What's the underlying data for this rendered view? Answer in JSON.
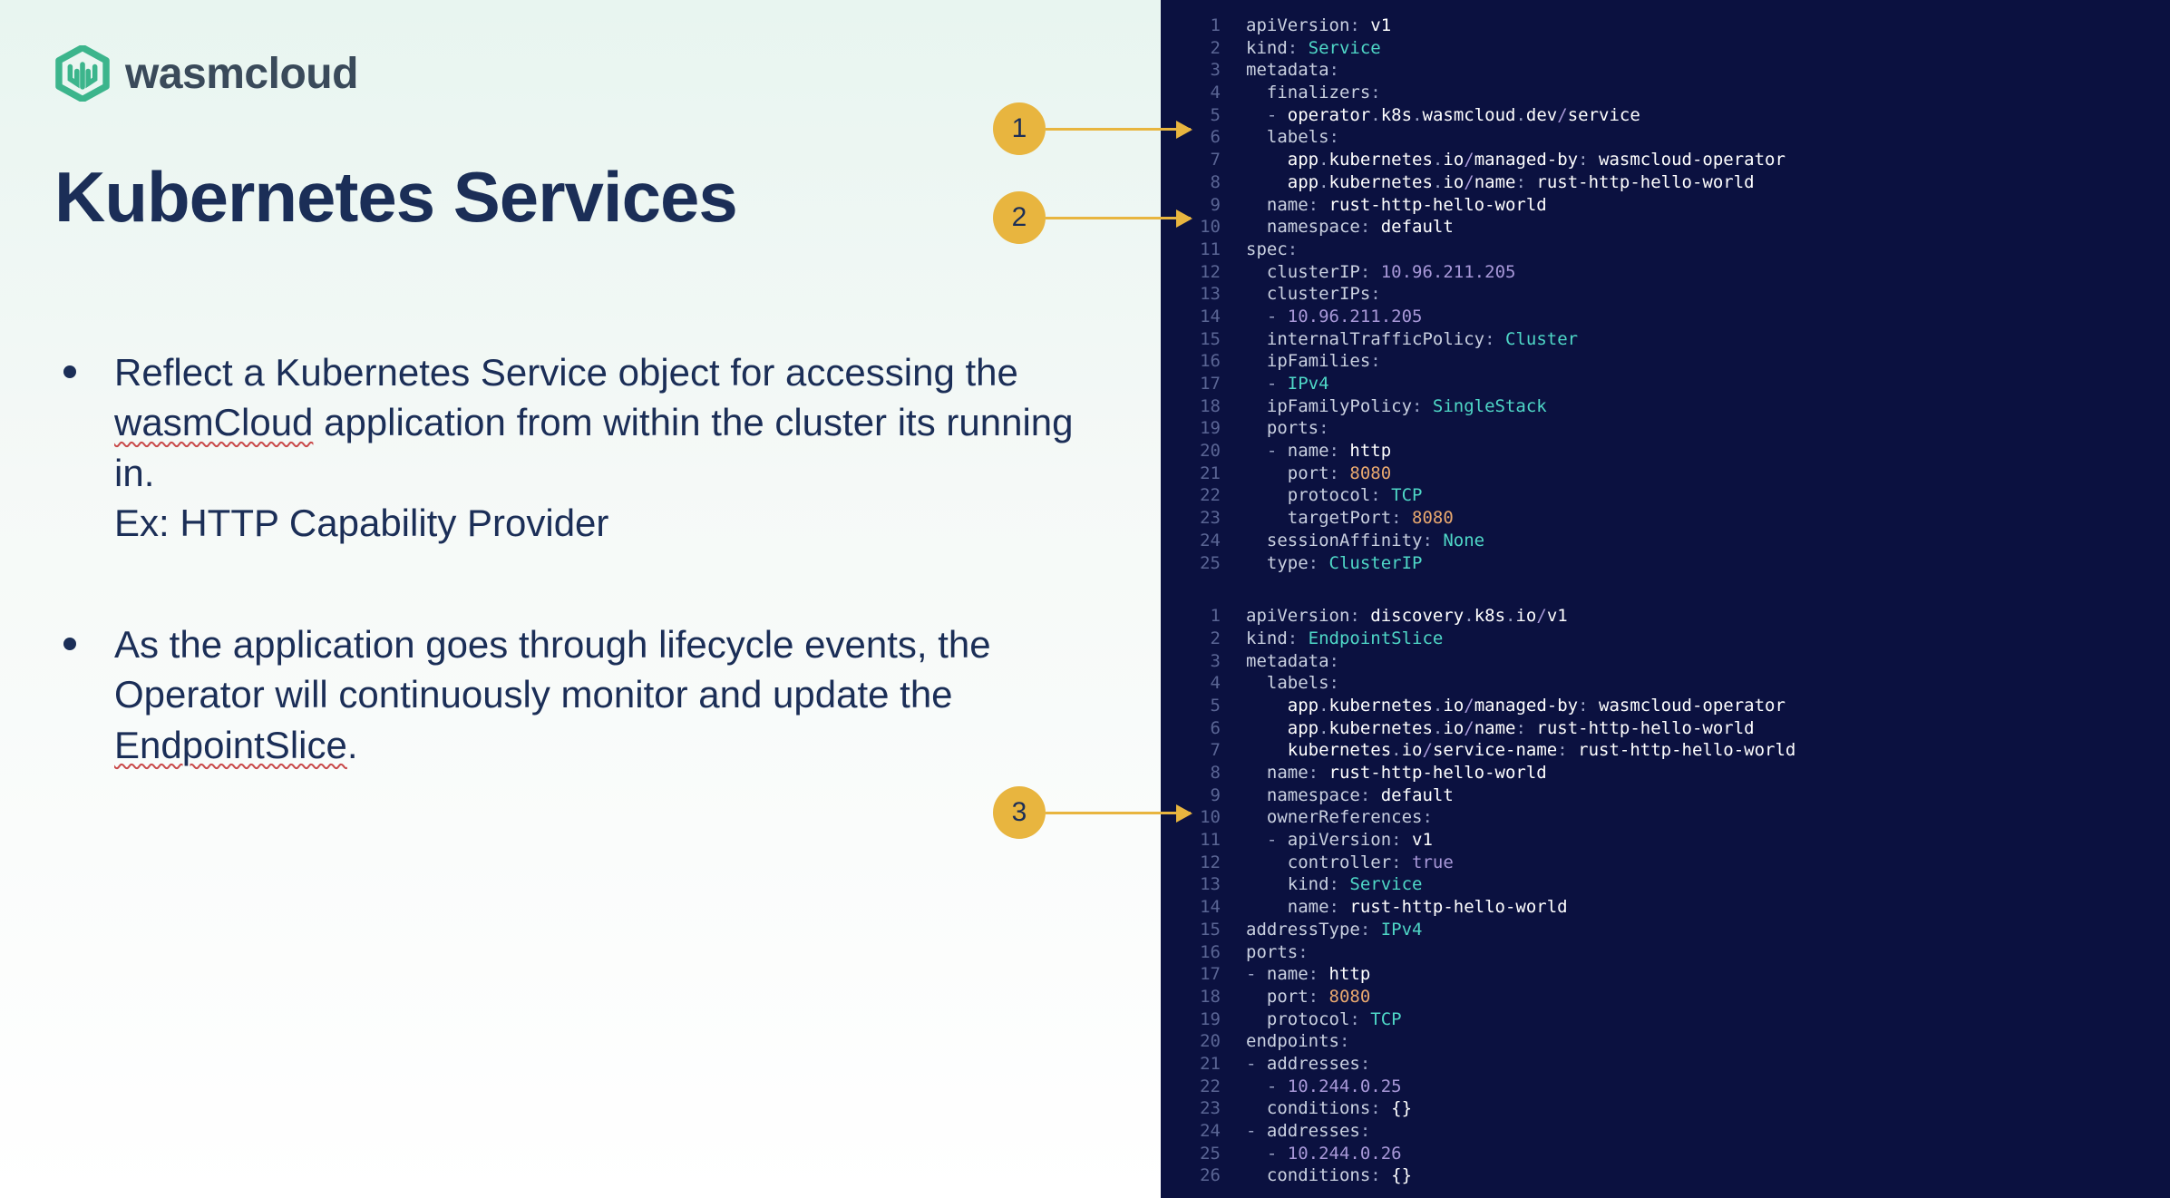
{
  "logo_text": "wasmcloud",
  "title": "Kubernetes Services",
  "bullet1_part1": "Reflect a Kubernetes Service object for accessing the ",
  "bullet1_underline1": "wasmCloud",
  "bullet1_part2": " application from within the cluster its running in.",
  "bullet1_ex": "Ex: HTTP Capability Provider",
  "bullet2_part1": "As the application goes through lifecycle events, the Operator will continuously monitor and update the ",
  "bullet2_underline": "EndpointSlice",
  "bullet2_part2": ".",
  "annot": {
    "a1": "1",
    "a2": "2",
    "a3": "3"
  },
  "code1": [
    {
      "n": "1",
      "segs": [
        [
          "apiVersion",
          "key"
        ],
        [
          ": ",
          "p"
        ],
        [
          "v1",
          "white"
        ]
      ]
    },
    {
      "n": "2",
      "segs": [
        [
          "kind",
          "key"
        ],
        [
          ": ",
          "p"
        ],
        [
          "Service",
          "cyan"
        ]
      ]
    },
    {
      "n": "3",
      "segs": [
        [
          "metadata",
          "key"
        ],
        [
          ":",
          "p"
        ]
      ]
    },
    {
      "n": "4",
      "segs": [
        [
          "  finalizers",
          "key"
        ],
        [
          ":",
          "p"
        ]
      ]
    },
    {
      "n": "5",
      "segs": [
        [
          "  - ",
          "dash"
        ],
        [
          "operator",
          "white"
        ],
        [
          ".",
          "p"
        ],
        [
          "k8s",
          "white"
        ],
        [
          ".",
          "p"
        ],
        [
          "wasmcloud",
          "white"
        ],
        [
          ".",
          "p"
        ],
        [
          "dev",
          "white"
        ],
        [
          "/",
          "purple"
        ],
        [
          "service",
          "white"
        ]
      ]
    },
    {
      "n": "6",
      "segs": [
        [
          "  labels",
          "key"
        ],
        [
          ":",
          "p"
        ]
      ]
    },
    {
      "n": "7",
      "segs": [
        [
          "    app",
          "white"
        ],
        [
          ".",
          "p"
        ],
        [
          "kubernetes",
          "white"
        ],
        [
          ".",
          "p"
        ],
        [
          "io",
          "white"
        ],
        [
          "/",
          "purple"
        ],
        [
          "managed-by",
          "white"
        ],
        [
          ": ",
          "p"
        ],
        [
          "wasmcloud-operator",
          "white"
        ]
      ]
    },
    {
      "n": "8",
      "segs": [
        [
          "    app",
          "white"
        ],
        [
          ".",
          "p"
        ],
        [
          "kubernetes",
          "white"
        ],
        [
          ".",
          "p"
        ],
        [
          "io",
          "white"
        ],
        [
          "/",
          "purple"
        ],
        [
          "name",
          "white"
        ],
        [
          ": ",
          "p"
        ],
        [
          "rust-http-hello-world",
          "white"
        ]
      ]
    },
    {
      "n": "9",
      "segs": [
        [
          "  name",
          "key"
        ],
        [
          ": ",
          "p"
        ],
        [
          "rust-http-hello-world",
          "white"
        ]
      ]
    },
    {
      "n": "10",
      "segs": [
        [
          "  namespace",
          "key"
        ],
        [
          ": ",
          "p"
        ],
        [
          "default",
          "white"
        ]
      ]
    },
    {
      "n": "11",
      "segs": [
        [
          "spec",
          "key"
        ],
        [
          ":",
          "p"
        ]
      ]
    },
    {
      "n": "12",
      "segs": [
        [
          "  clusterIP",
          "key"
        ],
        [
          ": ",
          "p"
        ],
        [
          "10.96.211.205",
          "purple"
        ]
      ]
    },
    {
      "n": "13",
      "segs": [
        [
          "  clusterIPs",
          "key"
        ],
        [
          ":",
          "p"
        ]
      ]
    },
    {
      "n": "14",
      "segs": [
        [
          "  - ",
          "dash"
        ],
        [
          "10.96.211.205",
          "purple"
        ]
      ]
    },
    {
      "n": "15",
      "segs": [
        [
          "  internalTrafficPolicy",
          "key"
        ],
        [
          ": ",
          "p"
        ],
        [
          "Cluster",
          "cyan"
        ]
      ]
    },
    {
      "n": "16",
      "segs": [
        [
          "  ipFamilies",
          "key"
        ],
        [
          ":",
          "p"
        ]
      ]
    },
    {
      "n": "17",
      "segs": [
        [
          "  - ",
          "dash"
        ],
        [
          "IPv4",
          "cyan"
        ]
      ]
    },
    {
      "n": "18",
      "segs": [
        [
          "  ipFamilyPolicy",
          "key"
        ],
        [
          ": ",
          "p"
        ],
        [
          "SingleStack",
          "cyan"
        ]
      ]
    },
    {
      "n": "19",
      "segs": [
        [
          "  ports",
          "key"
        ],
        [
          ":",
          "p"
        ]
      ]
    },
    {
      "n": "20",
      "segs": [
        [
          "  - ",
          "dash"
        ],
        [
          "name",
          "key"
        ],
        [
          ": ",
          "p"
        ],
        [
          "http",
          "white"
        ]
      ]
    },
    {
      "n": "21",
      "segs": [
        [
          "    port",
          "key"
        ],
        [
          ": ",
          "p"
        ],
        [
          "8080",
          "orange"
        ]
      ]
    },
    {
      "n": "22",
      "segs": [
        [
          "    protocol",
          "key"
        ],
        [
          ": ",
          "p"
        ],
        [
          "TCP",
          "cyan"
        ]
      ]
    },
    {
      "n": "23",
      "segs": [
        [
          "    targetPort",
          "key"
        ],
        [
          ": ",
          "p"
        ],
        [
          "8080",
          "orange"
        ]
      ]
    },
    {
      "n": "24",
      "segs": [
        [
          "  sessionAffinity",
          "key"
        ],
        [
          ": ",
          "p"
        ],
        [
          "None",
          "cyan"
        ]
      ]
    },
    {
      "n": "25",
      "segs": [
        [
          "  type",
          "key"
        ],
        [
          ": ",
          "p"
        ],
        [
          "ClusterIP",
          "cyan"
        ]
      ]
    }
  ],
  "code2": [
    {
      "n": "1",
      "segs": [
        [
          "apiVersion",
          "key"
        ],
        [
          ": ",
          "p"
        ],
        [
          "discovery",
          "white"
        ],
        [
          ".",
          "p"
        ],
        [
          "k8s",
          "white"
        ],
        [
          ".",
          "p"
        ],
        [
          "io",
          "white"
        ],
        [
          "/",
          "purple"
        ],
        [
          "v1",
          "white"
        ]
      ]
    },
    {
      "n": "2",
      "segs": [
        [
          "kind",
          "key"
        ],
        [
          ": ",
          "p"
        ],
        [
          "EndpointSlice",
          "cyan"
        ]
      ]
    },
    {
      "n": "3",
      "segs": [
        [
          "metadata",
          "key"
        ],
        [
          ":",
          "p"
        ]
      ]
    },
    {
      "n": "4",
      "segs": [
        [
          "  labels",
          "key"
        ],
        [
          ":",
          "p"
        ]
      ]
    },
    {
      "n": "5",
      "segs": [
        [
          "    app",
          "white"
        ],
        [
          ".",
          "p"
        ],
        [
          "kubernetes",
          "white"
        ],
        [
          ".",
          "p"
        ],
        [
          "io",
          "white"
        ],
        [
          "/",
          "purple"
        ],
        [
          "managed-by",
          "white"
        ],
        [
          ": ",
          "p"
        ],
        [
          "wasmcloud-operator",
          "white"
        ]
      ]
    },
    {
      "n": "6",
      "segs": [
        [
          "    app",
          "white"
        ],
        [
          ".",
          "p"
        ],
        [
          "kubernetes",
          "white"
        ],
        [
          ".",
          "p"
        ],
        [
          "io",
          "white"
        ],
        [
          "/",
          "purple"
        ],
        [
          "name",
          "white"
        ],
        [
          ": ",
          "p"
        ],
        [
          "rust-http-hello-world",
          "white"
        ]
      ]
    },
    {
      "n": "7",
      "segs": [
        [
          "    kubernetes",
          "white"
        ],
        [
          ".",
          "p"
        ],
        [
          "io",
          "white"
        ],
        [
          "/",
          "purple"
        ],
        [
          "service-name",
          "white"
        ],
        [
          ": ",
          "p"
        ],
        [
          "rust-http-hello-world",
          "white"
        ]
      ]
    },
    {
      "n": "8",
      "segs": [
        [
          "  name",
          "key"
        ],
        [
          ": ",
          "p"
        ],
        [
          "rust-http-hello-world",
          "white"
        ]
      ]
    },
    {
      "n": "9",
      "segs": [
        [
          "  namespace",
          "key"
        ],
        [
          ": ",
          "p"
        ],
        [
          "default",
          "white"
        ]
      ]
    },
    {
      "n": "10",
      "segs": [
        [
          "  ownerReferences",
          "key"
        ],
        [
          ":",
          "p"
        ]
      ]
    },
    {
      "n": "11",
      "segs": [
        [
          "  - ",
          "dash"
        ],
        [
          "apiVersion",
          "key"
        ],
        [
          ": ",
          "p"
        ],
        [
          "v1",
          "white"
        ]
      ]
    },
    {
      "n": "12",
      "segs": [
        [
          "    controller",
          "key"
        ],
        [
          ": ",
          "p"
        ],
        [
          "true",
          "purple"
        ]
      ]
    },
    {
      "n": "13",
      "segs": [
        [
          "    kind",
          "key"
        ],
        [
          ": ",
          "p"
        ],
        [
          "Service",
          "cyan"
        ]
      ]
    },
    {
      "n": "14",
      "segs": [
        [
          "    name",
          "key"
        ],
        [
          ": ",
          "p"
        ],
        [
          "rust-http-hello-world",
          "white"
        ]
      ]
    },
    {
      "n": "15",
      "segs": [
        [
          "addressType",
          "key"
        ],
        [
          ": ",
          "p"
        ],
        [
          "IPv4",
          "cyan"
        ]
      ]
    },
    {
      "n": "16",
      "segs": [
        [
          "ports",
          "key"
        ],
        [
          ":",
          "p"
        ]
      ]
    },
    {
      "n": "17",
      "segs": [
        [
          "- ",
          "dash"
        ],
        [
          "name",
          "key"
        ],
        [
          ": ",
          "p"
        ],
        [
          "http",
          "white"
        ]
      ]
    },
    {
      "n": "18",
      "segs": [
        [
          "  port",
          "key"
        ],
        [
          ": ",
          "p"
        ],
        [
          "8080",
          "orange"
        ]
      ]
    },
    {
      "n": "19",
      "segs": [
        [
          "  protocol",
          "key"
        ],
        [
          ": ",
          "p"
        ],
        [
          "TCP",
          "cyan"
        ]
      ]
    },
    {
      "n": "20",
      "segs": [
        [
          "endpoints",
          "key"
        ],
        [
          ":",
          "p"
        ]
      ]
    },
    {
      "n": "21",
      "segs": [
        [
          "- ",
          "dash"
        ],
        [
          "addresses",
          "key"
        ],
        [
          ":",
          "p"
        ]
      ]
    },
    {
      "n": "22",
      "segs": [
        [
          "  - ",
          "dash"
        ],
        [
          "10.244.0.25",
          "purple"
        ]
      ]
    },
    {
      "n": "23",
      "segs": [
        [
          "  conditions",
          "key"
        ],
        [
          ": ",
          "p"
        ],
        [
          "{}",
          "white"
        ]
      ]
    },
    {
      "n": "24",
      "segs": [
        [
          "- ",
          "dash"
        ],
        [
          "addresses",
          "key"
        ],
        [
          ":",
          "p"
        ]
      ]
    },
    {
      "n": "25",
      "segs": [
        [
          "  - ",
          "dash"
        ],
        [
          "10.244.0.26",
          "purple"
        ]
      ]
    },
    {
      "n": "26",
      "segs": [
        [
          "  conditions",
          "key"
        ],
        [
          ": ",
          "p"
        ],
        [
          "{}",
          "white"
        ]
      ]
    }
  ]
}
